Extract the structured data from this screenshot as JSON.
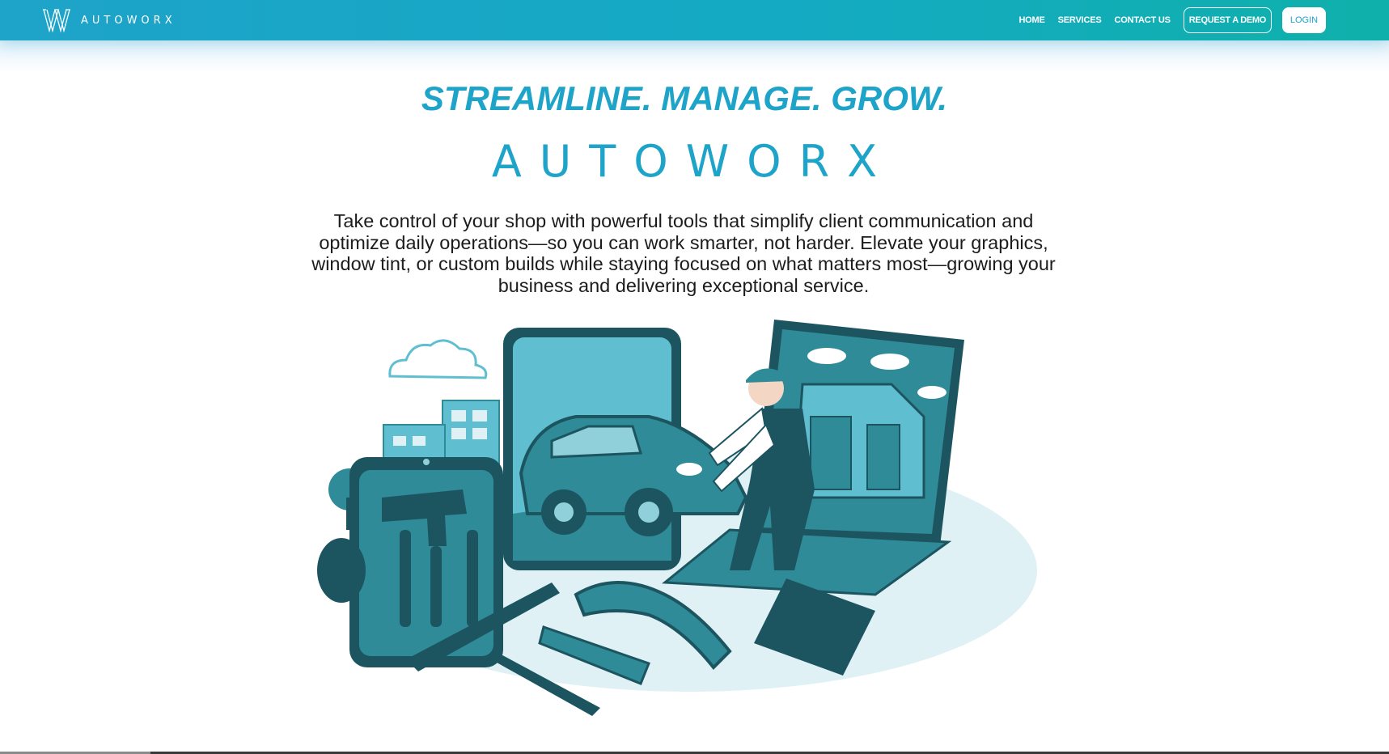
{
  "navbar": {
    "brand_name": "AUTOWORX",
    "links": [
      "HOME",
      "SERVICES",
      "CONTACT US"
    ],
    "demo_label": "REQUEST A DEMO",
    "login_label": "LOGIN"
  },
  "hero": {
    "tagline": "STREAMLINE. MANAGE. GROW.",
    "wordmark": "AUTOWORX",
    "description": "Take control of your shop with powerful tools that simplify client communication and optimize daily operations—so you can work smarter, not harder. Elevate your graphics, window tint, or custom builds while staying focused on what matters most—growing your business and delivering exceptional service."
  },
  "colors": {
    "brand_accent": "#1ea3c9",
    "nav_gradient_end": "#0fb0ab",
    "illustration_dark": "#1c5560",
    "illustration_mid": "#2f8b98",
    "illustration_light": "#8fd0db"
  },
  "icons": {
    "brand_logo": "autoworx-logo-icon"
  }
}
